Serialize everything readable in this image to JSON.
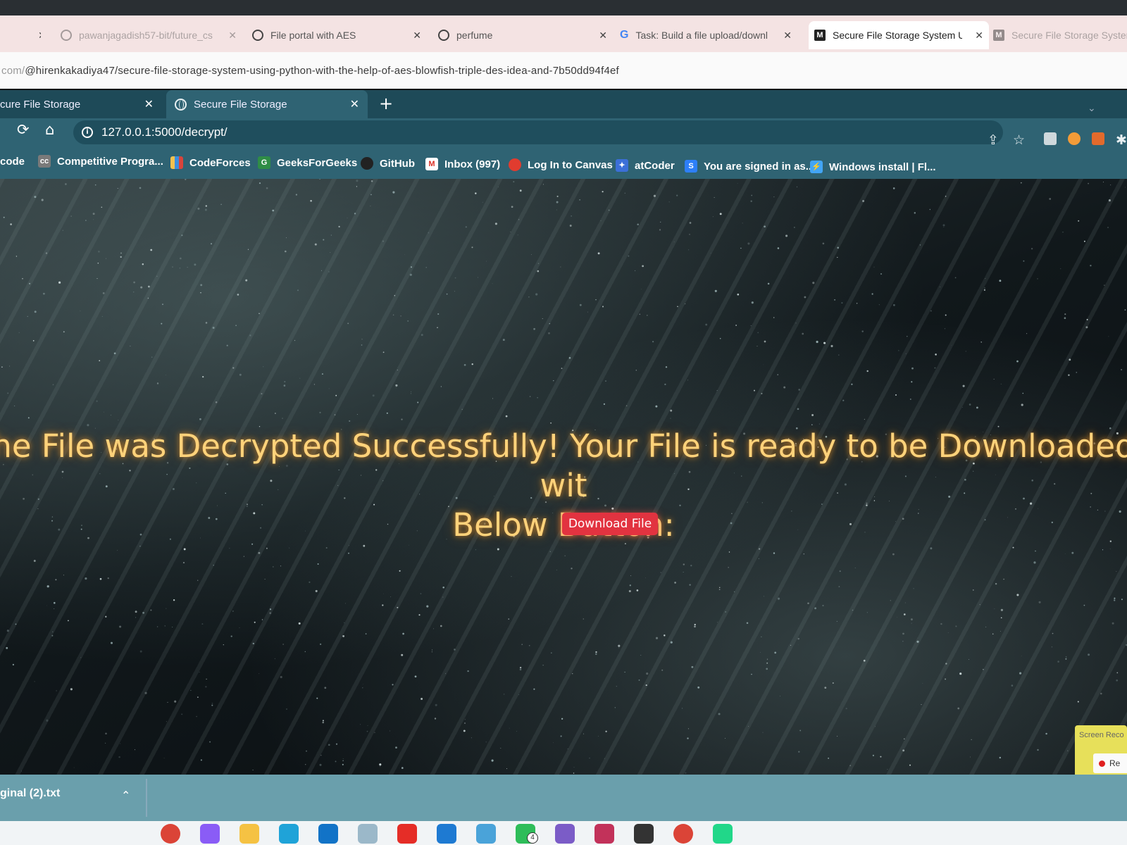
{
  "outer_browser": {
    "tabs": [
      {
        "title": "pawanjagadish57-bit/future_cs",
        "icon": "github-icon"
      },
      {
        "title": "File portal with AES",
        "icon": "globe-icon"
      },
      {
        "title": "perfume",
        "icon": "globe-icon"
      },
      {
        "title": "Task: Build a file upload/downl",
        "icon": "google-icon"
      },
      {
        "title": "Secure File Storage System Usi",
        "icon": "medium-icon"
      },
      {
        "title": "Secure File Storage System U",
        "icon": "medium-icon"
      }
    ],
    "url_prefix": "com/",
    "url": "@hirenkakadiya47/secure-file-storage-system-using-python-with-the-help-of-aes-blowfish-triple-des-idea-and-7b50dd94f4ef"
  },
  "inner_browser": {
    "tabs": [
      {
        "title": "cure File Storage"
      },
      {
        "title": "Secure File Storage"
      }
    ],
    "address": "127.0.0.1:5000/decrypt/",
    "bookmarks": [
      {
        "label": "code",
        "color": "#333333"
      },
      {
        "label": "Competitive Progra...",
        "color": "#7a7a7a"
      },
      {
        "label": "CodeForces",
        "color": "#f2c14e"
      },
      {
        "label": "GeeksForGeeks",
        "color": "#2f8d46"
      },
      {
        "label": "GitHub",
        "color": "#222222"
      },
      {
        "label": "Inbox (997)",
        "color": "#d93025"
      },
      {
        "label": "Log In to Canvas",
        "color": "#e13c2f"
      },
      {
        "label": "atCoder",
        "color": "#3b6fd8"
      },
      {
        "label": "You are signed in as...",
        "color": "#2d7ff9"
      },
      {
        "label": "Windows install | Fl...",
        "color": "#42a5f5"
      }
    ]
  },
  "page": {
    "headline_line1": "he File was Decrypted Successfully! Your File is ready to be Downloaded wit",
    "headline_line2": "Below Button:",
    "download_button": "Download File",
    "headline_color": "#ffd27a",
    "button_color": "#e23340"
  },
  "screen_recorder": {
    "title": "Screen Reco",
    "button": "Re"
  },
  "download_bar": {
    "file": "ginal (2).txt"
  },
  "taskbar": {
    "apps": [
      {
        "name": "chrome-icon",
        "color": "#db4437"
      },
      {
        "name": "copilot-icon",
        "color": "#8a5cf6"
      },
      {
        "name": "file-explorer-icon",
        "color": "#f5c243"
      },
      {
        "name": "edge-icon",
        "color": "#1fa3d8"
      },
      {
        "name": "outlook-icon",
        "color": "#1273c7"
      },
      {
        "name": "photos-icon",
        "color": "#9bb8c9"
      },
      {
        "name": "youtube-icon",
        "color": "#e52d27"
      },
      {
        "name": "vscode-icon",
        "color": "#1e7ad2"
      },
      {
        "name": "display-icon",
        "color": "#4aa3d9"
      },
      {
        "name": "whatsapp-icon",
        "color": "#2ebd59"
      },
      {
        "name": "visual-studio-icon",
        "color": "#7b5cc7"
      },
      {
        "name": "screen-recorder-icon",
        "color": "#c2325a"
      },
      {
        "name": "media-player-icon",
        "color": "#333333"
      },
      {
        "name": "chrome-profile-icon",
        "color": "#db4437"
      },
      {
        "name": "pycharm-icon",
        "color": "#21d789"
      }
    ],
    "whatsapp_badge": "4"
  }
}
